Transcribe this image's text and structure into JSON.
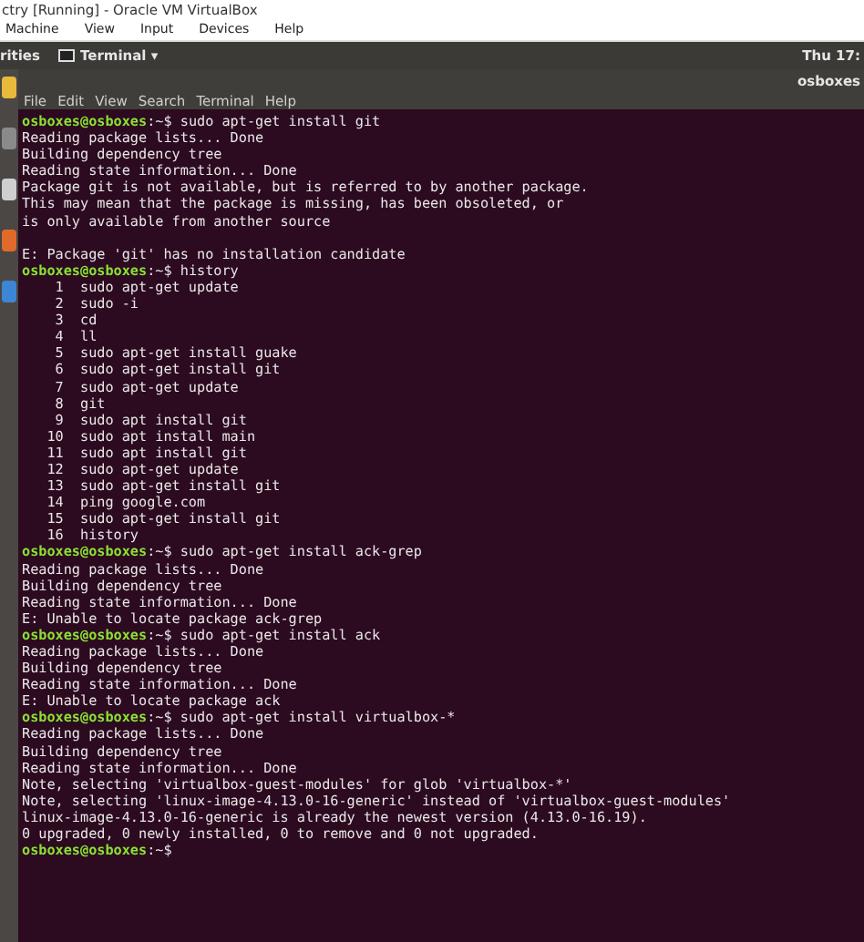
{
  "window": {
    "title": "ctry [Running] - Oracle VM VirtualBox"
  },
  "menu": [
    "Machine",
    "View",
    "Input",
    "Devices",
    "Help"
  ],
  "top_bar": {
    "activities": "rities",
    "app": "Terminal",
    "app_caret": "▾",
    "clock": "Thu 17:"
  },
  "terminal": {
    "title": "osboxes",
    "menu": [
      "File",
      "Edit",
      "View",
      "Search",
      "Terminal",
      "Help"
    ],
    "lines": [
      {
        "kind": "prompt",
        "user": "osboxes@osboxes",
        "path": ":~$",
        "command": "sudo apt-get install git"
      },
      {
        "kind": "output",
        "text": "Reading package lists... Done"
      },
      {
        "kind": "output",
        "text": "Building dependency tree"
      },
      {
        "kind": "output",
        "text": "Reading state information... Done"
      },
      {
        "kind": "output",
        "text": "Package git is not available, but is referred to by another package."
      },
      {
        "kind": "output",
        "text": "This may mean that the package is missing, has been obsoleted, or"
      },
      {
        "kind": "output",
        "text": "is only available from another source"
      },
      {
        "kind": "blank"
      },
      {
        "kind": "output",
        "text": "E: Package 'git' has no installation candidate"
      },
      {
        "kind": "prompt",
        "user": "osboxes@osboxes",
        "path": ":~$",
        "command": "history"
      },
      {
        "kind": "output",
        "text": "    1  sudo apt-get update"
      },
      {
        "kind": "output",
        "text": "    2  sudo -i"
      },
      {
        "kind": "output",
        "text": "    3  cd"
      },
      {
        "kind": "output",
        "text": "    4  ll"
      },
      {
        "kind": "output",
        "text": "    5  sudo apt-get install guake"
      },
      {
        "kind": "output",
        "text": "    6  sudo apt-get install git"
      },
      {
        "kind": "output",
        "text": "    7  sudo apt-get update"
      },
      {
        "kind": "output",
        "text": "    8  git"
      },
      {
        "kind": "output",
        "text": "    9  sudo apt install git"
      },
      {
        "kind": "output",
        "text": "   10  sudo apt install main"
      },
      {
        "kind": "output",
        "text": "   11  sudo apt install git"
      },
      {
        "kind": "output",
        "text": "   12  sudo apt-get update"
      },
      {
        "kind": "output",
        "text": "   13  sudo apt-get install git"
      },
      {
        "kind": "output",
        "text": "   14  ping google.com"
      },
      {
        "kind": "output",
        "text": "   15  sudo apt-get install git"
      },
      {
        "kind": "output",
        "text": "   16  history"
      },
      {
        "kind": "prompt",
        "user": "osboxes@osboxes",
        "path": ":~$",
        "command": "sudo apt-get install ack-grep"
      },
      {
        "kind": "output",
        "text": "Reading package lists... Done"
      },
      {
        "kind": "output",
        "text": "Building dependency tree"
      },
      {
        "kind": "output",
        "text": "Reading state information... Done"
      },
      {
        "kind": "output",
        "text": "E: Unable to locate package ack-grep"
      },
      {
        "kind": "prompt",
        "user": "osboxes@osboxes",
        "path": ":~$",
        "command": "sudo apt-get install ack"
      },
      {
        "kind": "output",
        "text": "Reading package lists... Done"
      },
      {
        "kind": "output",
        "text": "Building dependency tree"
      },
      {
        "kind": "output",
        "text": "Reading state information... Done"
      },
      {
        "kind": "output",
        "text": "E: Unable to locate package ack"
      },
      {
        "kind": "prompt",
        "user": "osboxes@osboxes",
        "path": ":~$",
        "command": "sudo apt-get install virtualbox-*"
      },
      {
        "kind": "output",
        "text": "Reading package lists... Done"
      },
      {
        "kind": "output",
        "text": "Building dependency tree"
      },
      {
        "kind": "output",
        "text": "Reading state information... Done"
      },
      {
        "kind": "output",
        "text": "Note, selecting 'virtualbox-guest-modules' for glob 'virtualbox-*'"
      },
      {
        "kind": "output",
        "text": "Note, selecting 'linux-image-4.13.0-16-generic' instead of 'virtualbox-guest-modules'"
      },
      {
        "kind": "output",
        "text": "linux-image-4.13.0-16-generic is already the newest version (4.13.0-16.19)."
      },
      {
        "kind": "output",
        "text": "0 upgraded, 0 newly installed, 0 to remove and 0 not upgraded."
      },
      {
        "kind": "prompt",
        "user": "osboxes@osboxes",
        "path": ":~$"
      }
    ]
  }
}
